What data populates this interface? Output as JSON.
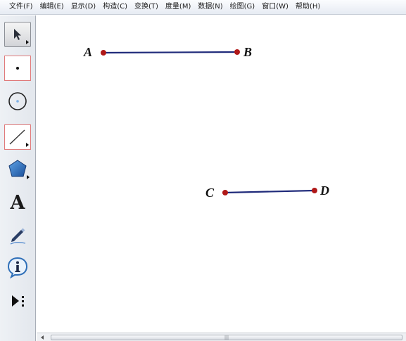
{
  "menu": [
    {
      "label": "文件(F)"
    },
    {
      "label": "编辑(E)"
    },
    {
      "label": "显示(D)"
    },
    {
      "label": "构造(C)"
    },
    {
      "label": "变换(T)"
    },
    {
      "label": "度量(M)"
    },
    {
      "label": "数据(N)"
    },
    {
      "label": "绘图(G)"
    },
    {
      "label": "窗口(W)"
    },
    {
      "label": "帮助(H)"
    }
  ],
  "toolbox": {
    "tools": [
      {
        "name": "arrow-select-tool",
        "icon": "arrow-pointer-icon"
      },
      {
        "name": "point-tool",
        "icon": "point-icon"
      },
      {
        "name": "compass-tool",
        "icon": "circle-icon"
      },
      {
        "name": "straightedge-tool",
        "icon": "line-segment-icon"
      },
      {
        "name": "polygon-tool",
        "icon": "pentagon-icon"
      },
      {
        "name": "text-tool",
        "icon": "text-a-icon",
        "glyph": "A"
      },
      {
        "name": "marker-tool",
        "icon": "pen-icon"
      },
      {
        "name": "information-tool",
        "icon": "info-bubble-icon"
      },
      {
        "name": "custom-tool",
        "icon": "play-more-icon"
      }
    ]
  },
  "canvas": {
    "points": {
      "A": "A",
      "B": "B",
      "C": "C",
      "D": "D"
    },
    "segments": [
      "AB",
      "CD"
    ],
    "colors": {
      "segment": "#1f2a7a",
      "point": "#b01818"
    }
  },
  "scrollbar": {
    "grip": "|||"
  }
}
